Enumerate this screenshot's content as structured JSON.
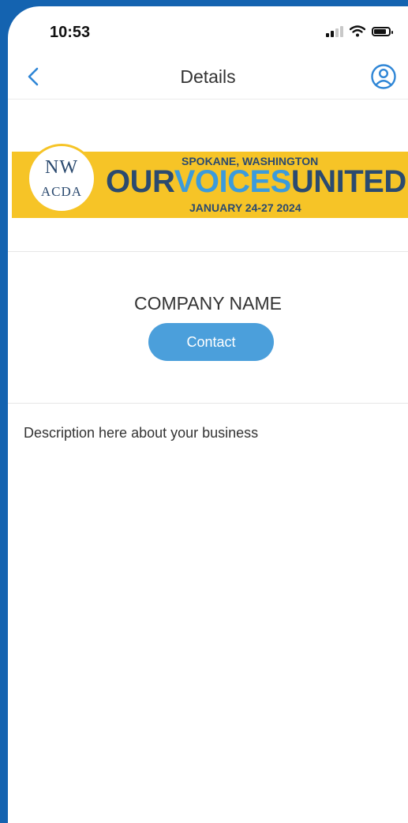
{
  "status_bar": {
    "time": "10:53",
    "icons": [
      "cellular-signal-icon",
      "wifi-icon",
      "battery-icon"
    ]
  },
  "nav": {
    "title": "Details",
    "back_icon": "chevron-left-icon",
    "profile_icon": "user-circle-icon"
  },
  "banner": {
    "logo_top": "NW",
    "logo_bottom": "ACDA",
    "location": "SPOKANE, WASHINGTON",
    "title_our": "OUR",
    "title_voices": "VOICES",
    "title_united": "UNITED",
    "dates": "JANUARY 24-27 2024"
  },
  "company": {
    "name": "COMPANY NAME",
    "contact_label": "Contact"
  },
  "description": "Description here about your business",
  "colors": {
    "frame": "#1463b0",
    "accent": "#4b9fdb",
    "banner_yellow": "#f6c427",
    "banner_navy": "#2b4a6f"
  }
}
